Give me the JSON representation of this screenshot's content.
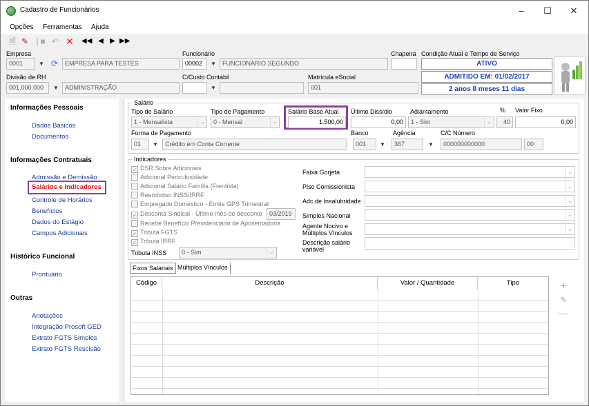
{
  "window": {
    "title": "Cadastro de Funcionários"
  },
  "menu": [
    "Opções",
    "Ferramentas",
    "Ajuda"
  ],
  "header": {
    "empresa_label": "Empresa",
    "empresa_code": "0001",
    "empresa_name": "EMPRESA PARA TESTES",
    "funcionario_label": "Funcionário",
    "funcionario_code": "00002",
    "funcionario_name": "FUNCIONARIO SEGUNDO",
    "chapeira_label": "Chapeira",
    "chapeira_value": "",
    "condicao_label": "Condição Atual e Tempo de Serviço",
    "status": "ATIVO",
    "admitido": "ADMITIDO EM: 01/02/2017",
    "tempo": "2 anos 8 meses 11 dias",
    "divisao_label": "Divisão de RH",
    "divisao_code": "001.000.000",
    "divisao_name": "ADMINISTRAÇÃO",
    "custo_label": "C/Custo Contábil",
    "custo_code": "",
    "custo_name": "",
    "matricula_label": "Matrícula eSocial",
    "matricula_value": "001"
  },
  "sidebar": {
    "sections": [
      {
        "title": "Informações Pessoais",
        "items": [
          "Dados Básicos",
          "Documentos"
        ]
      },
      {
        "title": "Informações Contratuais",
        "items": [
          "Admissão e Demissão",
          "Salários e Indicadores",
          "Controle de Horários",
          "Benefícios",
          "Dados do Estágio",
          "Campos Adicionais"
        ]
      },
      {
        "title": "Histórico Funcional",
        "items": [
          "Prontuário"
        ]
      },
      {
        "title": "Outras",
        "items": [
          "Anotações",
          "Integração Prosoft GED",
          "Extrato FGTS Simples",
          "Extrato FGTS Rescisão"
        ]
      }
    ],
    "active": "Salários e Indicadores"
  },
  "salario": {
    "group_title": "Salário",
    "tipo_salario_label": "Tipo de Salário",
    "tipo_salario_value": "1 - Mensalista",
    "tipo_pagamento_label": "Tipo de Pagamento",
    "tipo_pagamento_value": "0 - Mensal",
    "base_label": "Salário Base Atual",
    "base_value": "1.500,00",
    "ultimo_label": "Último Dissídio",
    "ultimo_value": "0,00",
    "adiant_label": "Adiantamento",
    "adiant_value": "1 - Sim",
    "pct_label": "%",
    "pct_value": "40",
    "fixo_label": "Valor Fixo",
    "fixo_value": "0,00",
    "forma_label": "Forma de Pagamento",
    "forma_code": "01",
    "forma_name": "Crédito em Conta Corrente",
    "banco_label": "Banco",
    "banco_value": "001",
    "agencia_label": "Agência",
    "agencia_value": "367",
    "conta_label": "C/C Número",
    "conta_value": "000000000000",
    "conta_dv": "00"
  },
  "indicadores": {
    "group_title": "Indicadores",
    "checks": [
      {
        "label": "DSR Sobre Adicionais",
        "checked": true
      },
      {
        "label": "Adicional Periculosidade",
        "checked": false
      },
      {
        "label": "Adicional Salário Família (Frentista)",
        "checked": false
      },
      {
        "label": "Reembolso INSS/IRRF",
        "checked": false
      },
      {
        "label": "Empregado Doméstico - Emite GPS Trimestral",
        "checked": false
      },
      {
        "label": "Desconta Sindical - Último mês de desconto",
        "checked": true
      },
      {
        "label": "Recebe Benefício Previdenciário de Aposentadoria",
        "checked": false
      },
      {
        "label": "Tributa FGTS",
        "checked": true
      },
      {
        "label": "Tributa IRRF",
        "checked": true
      }
    ],
    "sindical_mes": "03/2019",
    "inss_label": "Tributa INSS",
    "inss_value": "0 - Sim",
    "right_fields": [
      "Faixa Gorjeta",
      "Piso Comissionista",
      "Adc.de Insalubridade",
      "Simples Nacional",
      "Agente Nocivo e Múltiplos Vínculos",
      "Descrição salário variável"
    ]
  },
  "tabs": [
    "Fixos Salariais",
    "Múltiplos Vínculos"
  ],
  "grid": {
    "columns": [
      "Código",
      "Descrição",
      "Valor / Quantidade",
      "Tipo"
    ]
  },
  "colors": {
    "highlight": "#8e3ea0",
    "link": "#1a3c9a",
    "status_blue": "#1f3fbf",
    "active_red": "#e01010"
  }
}
